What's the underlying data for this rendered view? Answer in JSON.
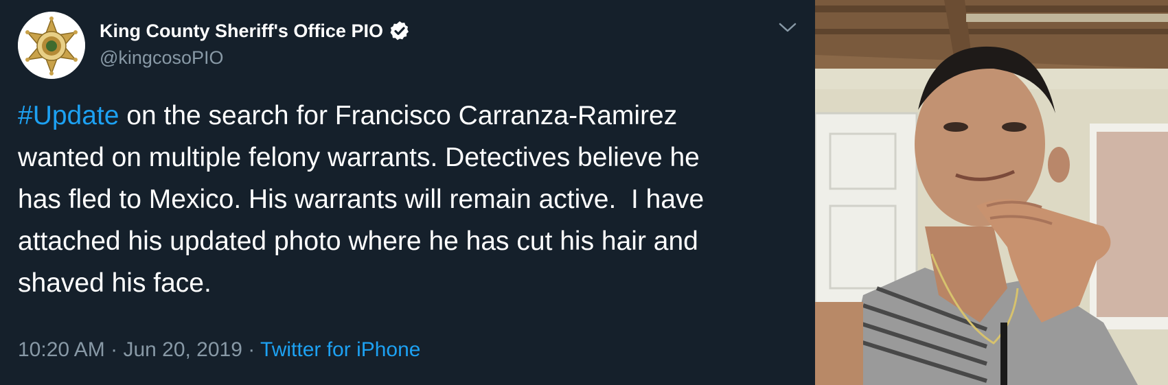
{
  "author": {
    "name": "King County Sheriff's Office PIO",
    "handle": "@kingcosoPIO",
    "avatar_icon": "sheriff-badge-icon",
    "verified_icon": "verified-badge-icon"
  },
  "tweet": {
    "hashtag": "#Update",
    "body": " on the search for Francisco Carranza-Ramirez\nwanted on multiple felony warrants. Detectives believe he\nhas fled to Mexico. His warrants will remain active.  I have\nattached his updated photo where he has cut his hair and\nshaved his face."
  },
  "meta": {
    "time": "10:20 AM",
    "separator": " · ",
    "date": "Jun 20, 2019",
    "source": "Twitter for iPhone"
  },
  "colors": {
    "background": "#15202b",
    "text": "#ffffff",
    "secondary_text": "#8899a6",
    "accent": "#1da1f2"
  },
  "icons": {
    "menu_caret": "chevron-down-icon"
  }
}
